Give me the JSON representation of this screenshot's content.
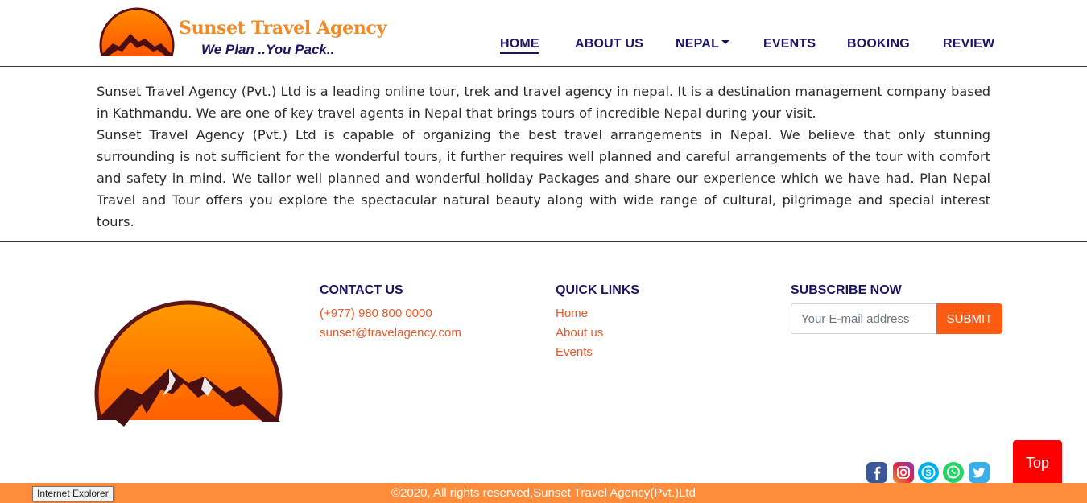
{
  "header": {
    "brand_name": "Sunset Travel Agency",
    "tagline": "We Plan ..You Pack..",
    "nav": [
      {
        "label": "HOME",
        "active": true
      },
      {
        "label": "ABOUT US",
        "active": false
      },
      {
        "label": "NEPAL",
        "active": false,
        "dropdown": true
      },
      {
        "label": "EVENTS",
        "active": false
      },
      {
        "label": "BOOKING",
        "active": false
      },
      {
        "label": "REVIEW",
        "active": false
      }
    ]
  },
  "about": {
    "paragraph_1": "Sunset Travel Agency (Pvt.) Ltd is a leading online tour, trek and travel agency in nepal. It is a destination management company based in Kathmandu. We are one of key travel agents in Nepal that brings tours of incredible Nepal during your visit.",
    "paragraph_2": "Sunset Travel Agency (Pvt.) Ltd is capable of organizing the best travel arrangements in Nepal. We believe that only stunning surrounding is not sufficient for the wonderful tours, it further requires well planned and careful arrangements of the tour with comfort and safety in mind. We tailor well planned and wonderful holiday Packages and share our experience which we have had. Plan Nepal Travel and Tour offers you explore the spectacular natural beauty along with wide range of cultural, pilgrimage and special interest tours."
  },
  "footer": {
    "contact": {
      "heading": "CONTACT US",
      "phone": "(+977) 980 800 0000",
      "email": "sunset@travelagency.com"
    },
    "quick_links": {
      "heading": "QUICK LINKS",
      "items": [
        "Home",
        "About us",
        "Events"
      ]
    },
    "subscribe": {
      "heading": "SUBSCRIBE NOW",
      "placeholder": "Your E-mail address",
      "button_label": "SUBMIT"
    },
    "social_icons": [
      "facebook-icon",
      "instagram-icon",
      "skype-icon",
      "whatsapp-icon",
      "twitter-icon"
    ],
    "top_button_label": "Top",
    "copyright": "©2020, All rights reserved,Sunset Travel Agency(Pvt.)Ltd"
  },
  "tooltip": {
    "text": "Internet Explorer"
  },
  "colors": {
    "nav_text": "#1b1464",
    "brand_orange": "#f08a24",
    "link_orange": "#e8582a",
    "submit_bg": "#ff5a12",
    "top_button_bg": "#ff0000",
    "bottom_bar_bg": "#ff8c3a",
    "facebook": "#3b5998",
    "skype": "#00aff0",
    "whatsapp": "#25d366",
    "twitter": "#1da1f2"
  }
}
